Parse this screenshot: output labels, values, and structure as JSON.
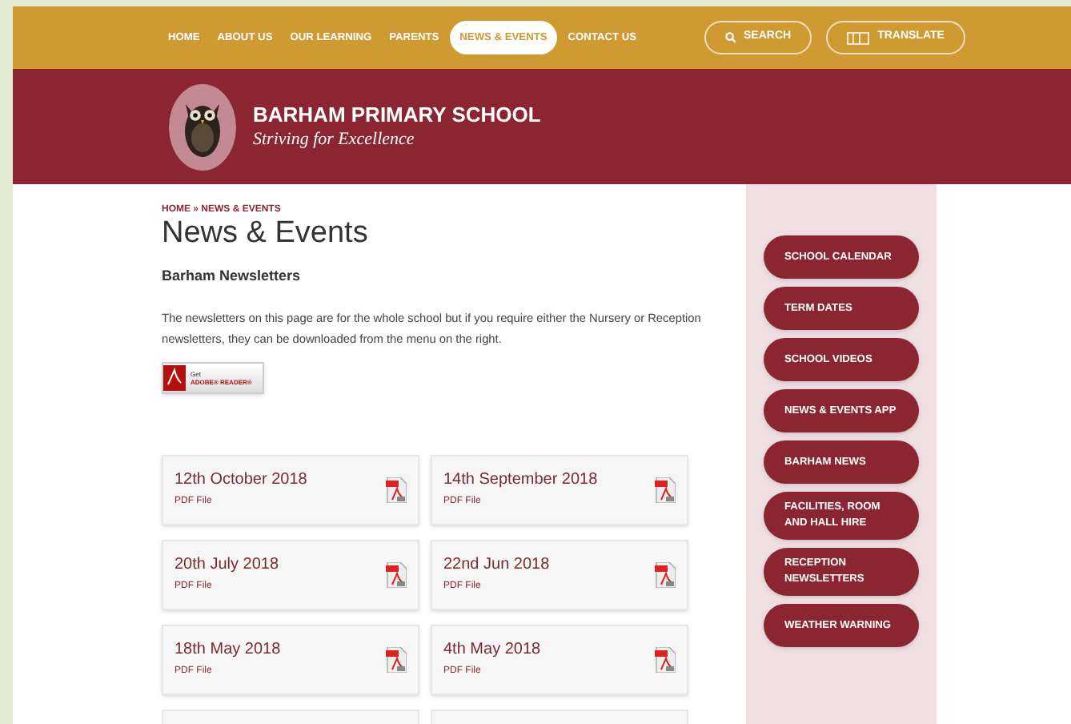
{
  "nav": {
    "items": [
      {
        "label": "HOME",
        "selected": false
      },
      {
        "label": "ABOUT US",
        "selected": false
      },
      {
        "label": "OUR LEARNING",
        "selected": false
      },
      {
        "label": "PARENTS",
        "selected": false
      },
      {
        "label": "NEWS & EVENTS",
        "selected": true
      },
      {
        "label": "CONTACT US",
        "selected": false
      }
    ],
    "search": "SEARCH",
    "translate": "TRANSLATE"
  },
  "header": {
    "title": "BARHAM PRIMARY SCHOOL",
    "tagline": "Striving for Excellence"
  },
  "breadcrumb": "HOME » NEWS & EVENTS",
  "page_title": "News & Events",
  "subtitle": "Barham Newsletters",
  "intro": "The newsletters on this page are for the whole school but if you require either the Nursery or Reception newsletters, they can be downloaded from the menu on the right.",
  "adobe_badge": {
    "line1": "Get",
    "line2": "ADOBE® READER®"
  },
  "newsletters": [
    {
      "title": "12th October 2018",
      "type": "PDF File"
    },
    {
      "title": "14th September 2018",
      "type": "PDF File"
    },
    {
      "title": "20th July 2018",
      "type": "PDF File"
    },
    {
      "title": "22nd Jun 2018",
      "type": "PDF File"
    },
    {
      "title": "18th May 2018",
      "type": "PDF File"
    },
    {
      "title": "4th May 2018",
      "type": "PDF File"
    }
  ],
  "sidebar": {
    "items": [
      "SCHOOL CALENDAR",
      "TERM DATES",
      "SCHOOL VIDEOS",
      "NEWS & EVENTS APP",
      "BARHAM NEWS",
      "FACILITIES, ROOM AND HALL HIRE",
      "RECEPTION NEWSLETTERS",
      "WEATHER WARNING"
    ]
  }
}
